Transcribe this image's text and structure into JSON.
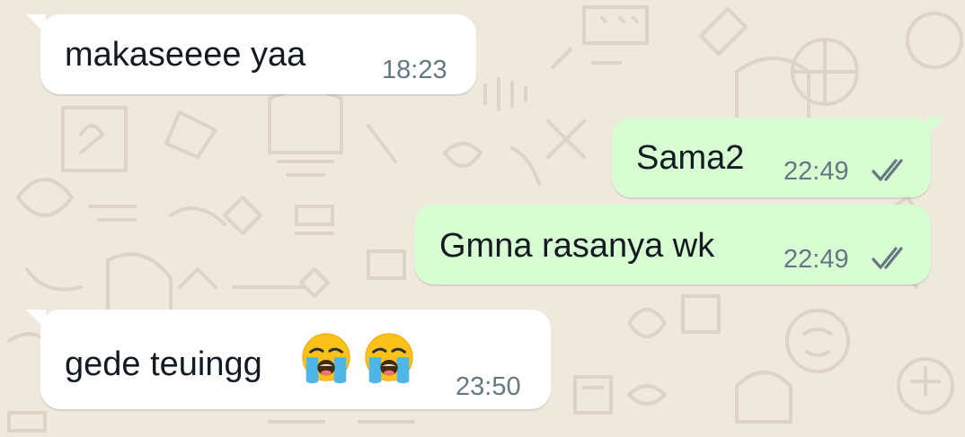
{
  "conversation": {
    "messages": [
      {
        "direction": "incoming",
        "text": "makaseeee yaa",
        "time": "18:23"
      },
      {
        "direction": "outgoing",
        "text": "Sama2",
        "time": "22:49",
        "status": "read"
      },
      {
        "direction": "outgoing",
        "text": "Gmna rasanya wk",
        "time": "22:49",
        "status": "read"
      },
      {
        "direction": "incoming",
        "text": "gede teuingg",
        "time": "23:50",
        "emoji": [
          "loudly-crying-face",
          "loudly-crying-face"
        ]
      }
    ]
  },
  "colors": {
    "background": "#efe8dd",
    "incoming_bubble": "#ffffff",
    "outgoing_bubble": "#d8fdd2",
    "text": "#111b21",
    "meta": "#667781"
  },
  "icons": {
    "read_receipt": "double-check-icon",
    "emoji": "loudly-crying-face-icon"
  }
}
